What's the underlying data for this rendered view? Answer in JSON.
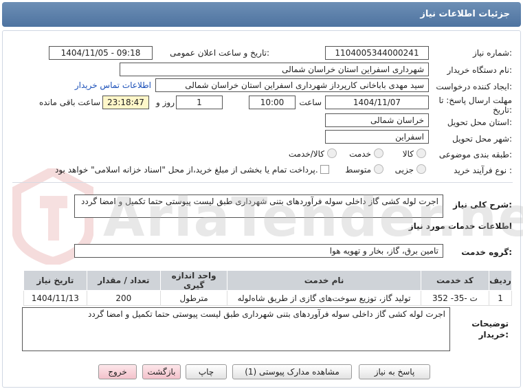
{
  "header": {
    "title": "جزئیات اطلاعات نیاز"
  },
  "form": {
    "need_number_label": "شماره نیاز:",
    "need_number": "1104005344000241",
    "announce_label": "تاریخ و ساعت اعلان عمومی:",
    "announce_value": "1404/11/05 - 09:18",
    "buyer_label": "نام دستگاه خریدار:",
    "buyer_value": "شهرداری اسفراین استان خراسان شمالی",
    "creator_label": "ایجاد کننده درخواست:",
    "creator_value": "سید مهدی  باباخانی کارپرداز   شهرداری اسفراین استان خراسان شمالی",
    "contact_link": "اطلاعات تماس خریدار",
    "deadline_label_1": "مهلت ارسال پاسخ: تا",
    "deadline_label_2": "تاریخ:",
    "deadline_date": "1404/11/07",
    "time_label": "ساعت",
    "deadline_time": "10:00",
    "days_value": "1",
    "days_label": "روز و",
    "remaining_value": "23:18:47",
    "remaining_label": "ساعت باقی مانده",
    "province_label": "استان محل تحویل:",
    "province_value": "خراسان شمالی",
    "city_label": "شهر محل تحویل:",
    "city_value": "اسفراین",
    "category_label": "طبقه بندی موضوعی:",
    "category_options": [
      "کالا",
      "خدمت",
      "کالا/خدمت"
    ],
    "process_label": "نوع فرآیند خرید :",
    "process_options": [
      "جزیی",
      "متوسط"
    ],
    "payment_note": "پرداخت تمام یا بخشی از مبلغ خرید،از محل \"اسناد خزانه اسلامی\" خواهد بود."
  },
  "summary": {
    "label": "شرح کلی نیاز:",
    "text": "اجرت لوله کشی گاز داخلی سوله فرآوردهای بتنی شهرداری طبق لیست پیوستی حتما تکمیل و امضا گردد"
  },
  "services": {
    "section_title": "اطلاعات خدمات مورد نیاز",
    "group_label": "گروه خدمت:",
    "group_value": "تامین برق، گاز، بخار و تهویه هوا",
    "columns": [
      "ردیف",
      "کد خدمت",
      "نام خدمت",
      "واحد اندازه گیری",
      "تعداد / مقدار",
      "تاریخ نیاز"
    ],
    "rows": [
      {
        "idx": "1",
        "code": "ت -35- 352",
        "name": "تولید گاز، توزیع سوخت‌های گازی از طریق شاه‌لوله",
        "unit": "مترطول",
        "qty": "200",
        "date": "1404/11/13"
      }
    ]
  },
  "buyer_notes": {
    "label_1": "توضیحات",
    "label_2": "خریدار:",
    "text": "اجرت لوله کشی گاز داخلی سوله فرآوردهای بتنی شهرداری طبق لیست پیوستی حتما تکمیل و امضا گردد"
  },
  "buttons": {
    "reply": "پاسخ به نیاز",
    "attachments": "مشاهده مدارک پیوستی (1)",
    "print": "چاپ",
    "back": "بازگشت",
    "exit": "خروج"
  }
}
